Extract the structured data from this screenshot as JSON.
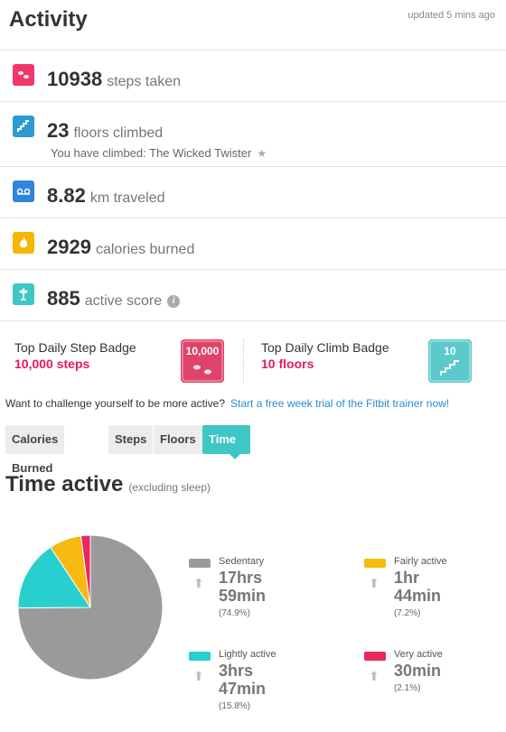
{
  "header": {
    "title": "Activity",
    "updated": "updated 5 mins ago"
  },
  "stats": [
    {
      "icon": "footsteps-icon",
      "color": "#f0366b",
      "value": "10938",
      "unit": "steps taken"
    },
    {
      "icon": "stairs-icon",
      "color": "#2b9bd0",
      "value": "23",
      "unit": "floors climbed",
      "subtext": "You have climbed: The Wicked Twister",
      "subicon": "star-icon"
    },
    {
      "icon": "distance-icon",
      "color": "#2f85d9",
      "value": "8.82",
      "unit": "km traveled"
    },
    {
      "icon": "flame-icon",
      "color": "#f7b500",
      "value": "2929",
      "unit": "calories burned"
    },
    {
      "icon": "flower-icon",
      "color": "#3fc6c6",
      "value": "885",
      "unit": "active score",
      "info": "i"
    }
  ],
  "badges": {
    "step": {
      "label": "Top Daily Step Badge",
      "value": "10,000 steps",
      "image_text": "10,000",
      "color": "#e0436a"
    },
    "climb": {
      "label": "Top Daily Climb Badge",
      "value": "10 floors",
      "image_text": "10",
      "color": "#5cc9cc"
    }
  },
  "challenge": {
    "text": "Want to challenge yourself to be more active?",
    "link": "Start a free week trial of the Fitbit trainer now!"
  },
  "tabs": [
    {
      "label": "Calories Burned",
      "active": false
    },
    {
      "label": "Steps",
      "active": false
    },
    {
      "label": "Floors",
      "active": false
    },
    {
      "label": "Time Active",
      "active": true
    }
  ],
  "section": {
    "title": "Time active",
    "subtitle": "(excluding sleep)"
  },
  "chart_data": {
    "type": "pie",
    "categories": [
      "Sedentary",
      "Lightly active",
      "Fairly active",
      "Very active"
    ],
    "values": [
      74.9,
      15.8,
      7.2,
      2.1
    ],
    "colors": [
      "#9a9a9a",
      "#27cfcf",
      "#f8b910",
      "#e8285e"
    ],
    "times": [
      [
        "17hrs",
        "59min"
      ],
      [
        "3hrs",
        "47min"
      ],
      [
        "1hr",
        "44min"
      ],
      [
        "30min"
      ]
    ],
    "percent_labels": [
      "(74.9%)",
      "(15.8%)",
      "(7.2%)",
      "(2.1%)"
    ]
  }
}
